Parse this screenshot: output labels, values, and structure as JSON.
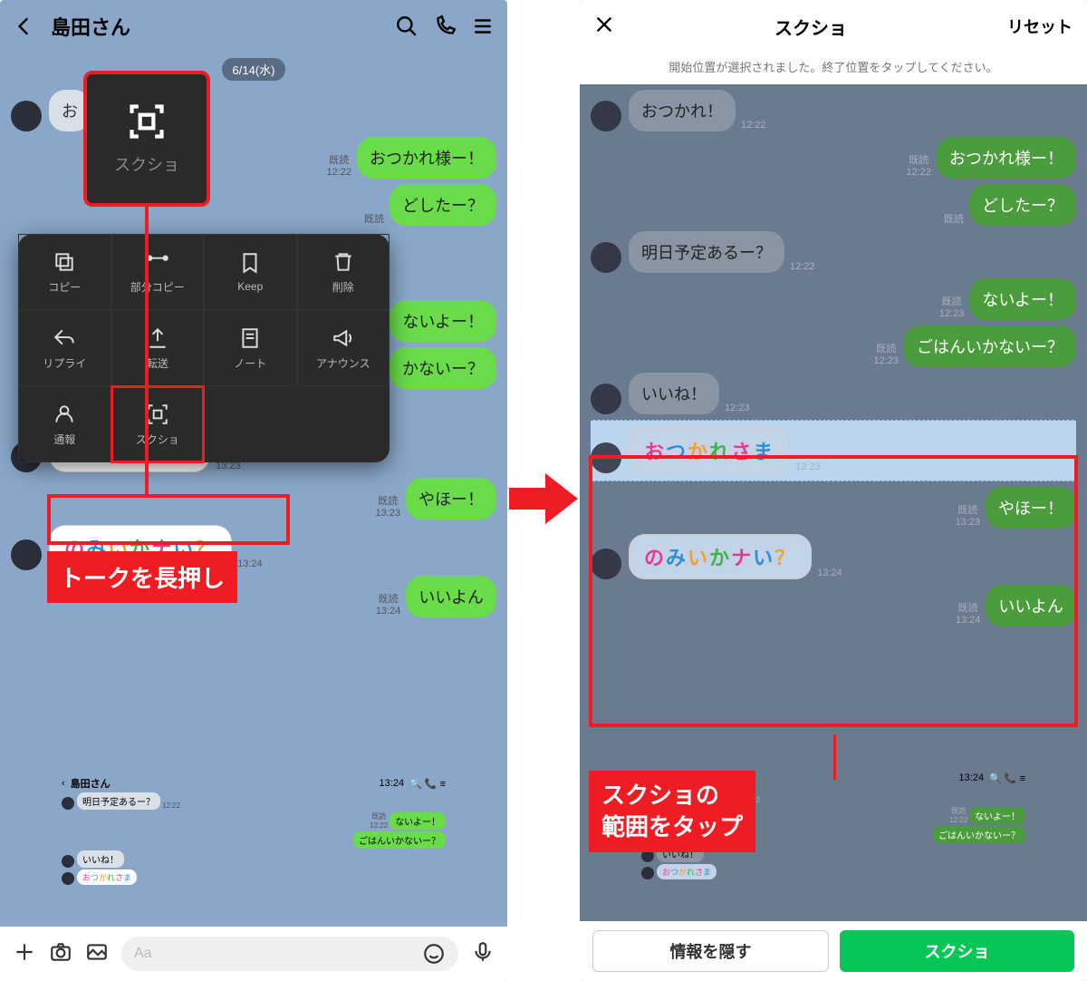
{
  "left": {
    "contact": "島田さん",
    "date_pill": "6/14(水)",
    "input_placeholder": "Aa",
    "big_menu_label": "スクショ",
    "context_menu": [
      {
        "label": "コピー"
      },
      {
        "label": "部分コピー"
      },
      {
        "label": "Keep"
      },
      {
        "label": "削除"
      },
      {
        "label": "リプライ"
      },
      {
        "label": "転送"
      },
      {
        "label": "ノート"
      },
      {
        "label": "アナウンス"
      },
      {
        "label": "通報"
      },
      {
        "label": "スクショ"
      }
    ],
    "messages": [
      {
        "side": "l",
        "text": "お",
        "time": ""
      },
      {
        "side": "r",
        "text": "おつかれ様ー！",
        "read": "既読",
        "time": "12:22"
      },
      {
        "side": "r",
        "text": "どしたー？",
        "read": "既読",
        "time": ""
      },
      {
        "side": "r",
        "text": "ないよー！",
        "read": "",
        "time": ""
      },
      {
        "side": "r",
        "text": "かないー？",
        "read": "",
        "time": ""
      }
    ],
    "deco1": "おつかれさま",
    "deco1_time": "13:23",
    "deco2": "のみいかナい？",
    "deco2_time": "13:24",
    "yaho": {
      "text": "やほー！",
      "read": "既読",
      "time": "13:23"
    },
    "iiyon": {
      "text": "いいよん",
      "read": "既読",
      "time": "13:24"
    },
    "callout": "トークを長押し",
    "mini": {
      "time": "13:24",
      "title": "島田さん",
      "m1": "明日予定あるー？",
      "t1": "12:22",
      "m2": "ないよー！",
      "m3": "ごはんいかないー？",
      "m4": "いいね！",
      "m5": "おつかれさま"
    }
  },
  "right": {
    "title": "スクショ",
    "reset": "リセット",
    "instruction": "開始位置が選択されました。終了位置をタップしてください。",
    "messages": [
      {
        "side": "l",
        "text": "おつかれ！",
        "time": "12:22"
      },
      {
        "side": "r",
        "text": "おつかれ様ー！",
        "read": "既読",
        "time": "12:22"
      },
      {
        "side": "r",
        "text": "どしたー？",
        "read": "既読",
        "time": ""
      },
      {
        "side": "l",
        "text": "明日予定あるー？",
        "time": "12:22"
      },
      {
        "side": "r",
        "text": "ないよー！",
        "read": "既読",
        "time": "12:23"
      },
      {
        "side": "r",
        "text": "ごはんいかないー？",
        "read": "既読",
        "time": "12:23"
      },
      {
        "side": "l",
        "text": "いいね！",
        "time": "12:23"
      }
    ],
    "deco1": "おつかれさま",
    "deco1_time": "13:23",
    "yaho": {
      "text": "やほー！",
      "read": "既読",
      "time": "13:23"
    },
    "deco2": "のみいかナい？",
    "deco2_time": "13:24",
    "iiyon": {
      "text": "いいよん",
      "read": "既読",
      "time": "13:24"
    },
    "callout": "スクショの\n範囲をタップ",
    "mini": {
      "time": "13:24",
      "title": "島田さん",
      "m1": "明日予定あるー？",
      "t1": "12:22",
      "m2": "ないよー！",
      "m3": "ごはんいかないー？",
      "m4": "いいね！",
      "m5": "おつかれさま"
    },
    "hide": "情報を隠す",
    "go": "スクショ"
  }
}
